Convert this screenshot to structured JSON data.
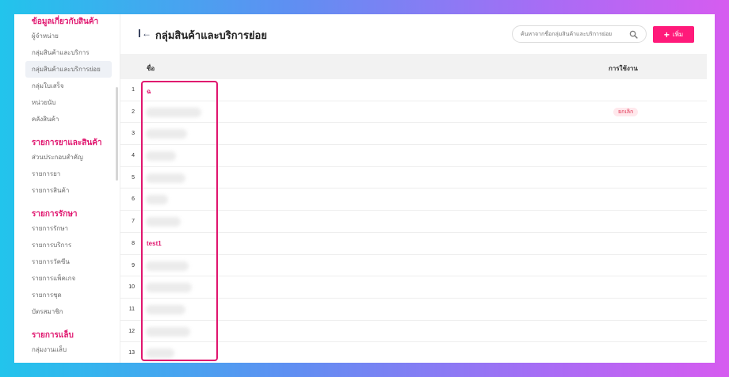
{
  "sidebar": {
    "sections": [
      {
        "heading": "ข้อมูลเกี่ยวกับสินค้า",
        "items": [
          {
            "label": "ผู้จำหน่าย"
          },
          {
            "label": "กลุ่มสินค้าและบริการ"
          },
          {
            "label": "กลุ่มสินค้าและบริการย่อย",
            "active": true
          },
          {
            "label": "กลุ่มใบเสร็จ"
          },
          {
            "label": "หน่วยนับ"
          },
          {
            "label": "คลังสินค้า"
          }
        ]
      },
      {
        "heading": "รายการยาและสินค้า",
        "items": [
          {
            "label": "ส่วนประกอบสำคัญ"
          },
          {
            "label": "รายการยา"
          },
          {
            "label": "รายการสินค้า"
          }
        ]
      },
      {
        "heading": "รายการรักษา",
        "items": [
          {
            "label": "รายการรักษา"
          },
          {
            "label": "รายการบริการ"
          },
          {
            "label": "รายการวัคซีน"
          },
          {
            "label": "รายการแพ็คเกจ"
          },
          {
            "label": "รายการชุด"
          },
          {
            "label": "บัตรสมาชิก"
          }
        ]
      },
      {
        "heading": "รายการแล็บ",
        "items": [
          {
            "label": "กลุ่มงานแล็บ"
          }
        ]
      }
    ]
  },
  "header": {
    "title": "กลุ่มสินค้าและบริการย่อย",
    "search_placeholder": "ค้นหาจากชื่อกลุ่มสินค้าและบริการย่อย",
    "add_label": "เพิ่ม"
  },
  "table": {
    "columns": {
      "name": "ชื่อ",
      "usage": "การใช้งาน"
    },
    "rows": [
      {
        "num": "1",
        "name": "ฉ",
        "status": ""
      },
      {
        "num": "2",
        "name": "",
        "status": "ยกเลิก"
      },
      {
        "num": "3",
        "name": "",
        "status": ""
      },
      {
        "num": "4",
        "name": "",
        "status": ""
      },
      {
        "num": "5",
        "name": "",
        "status": ""
      },
      {
        "num": "6",
        "name": "",
        "status": ""
      },
      {
        "num": "7",
        "name": "",
        "status": ""
      },
      {
        "num": "8",
        "name": "test1",
        "status": ""
      },
      {
        "num": "9",
        "name": "",
        "status": ""
      },
      {
        "num": "10",
        "name": "",
        "status": ""
      },
      {
        "num": "11",
        "name": "",
        "status": ""
      },
      {
        "num": "12",
        "name": "",
        "status": ""
      },
      {
        "num": "13",
        "name": "",
        "status": ""
      }
    ]
  },
  "colors": {
    "accent": "#e0156e",
    "button": "#ff1a7a",
    "badge_bg": "#ffe8ec",
    "badge_text": "#e03050"
  }
}
